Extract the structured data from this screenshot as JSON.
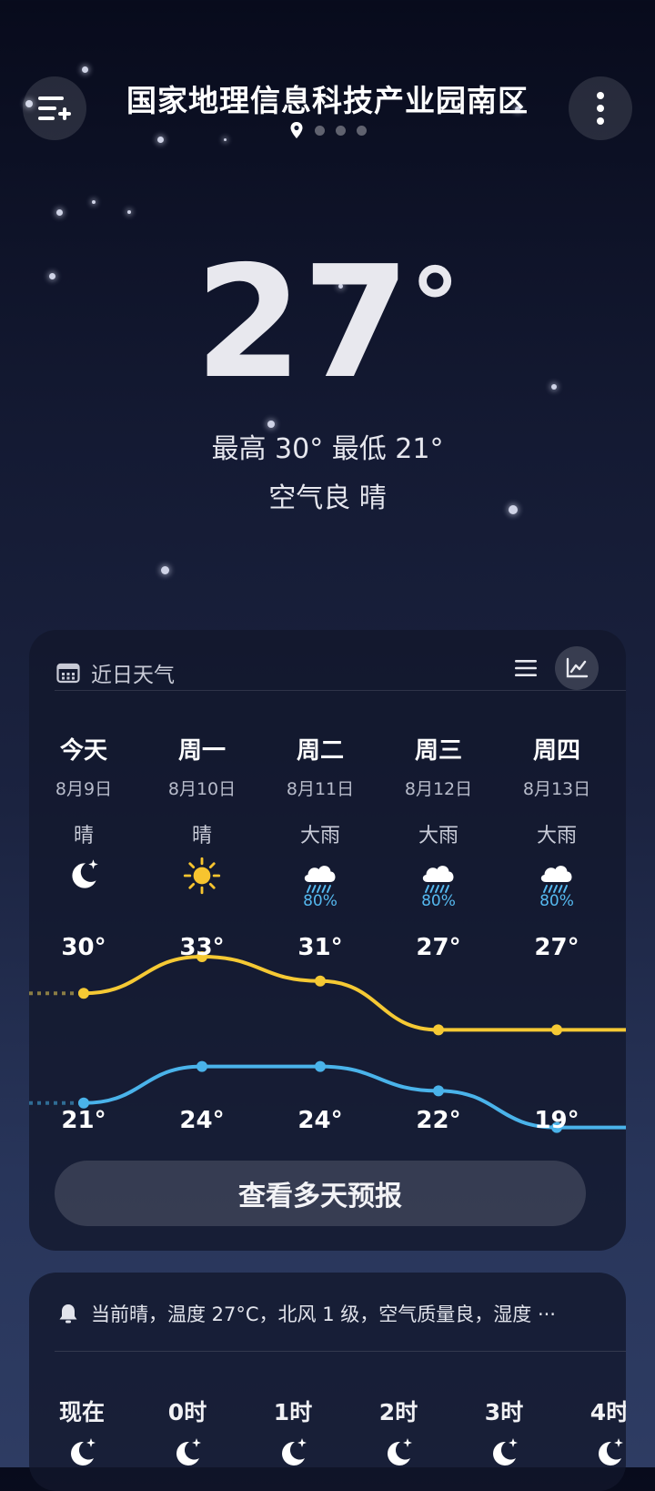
{
  "header": {
    "city": "国家地理信息科技产业园南区",
    "menu_icon": "menu-add-icon",
    "more_icon": "more-vertical-icon",
    "page_count": 4
  },
  "current": {
    "temperature": "27",
    "degree": "°",
    "hilo": "最高 30° 最低 21°",
    "air_condition": "空气良  晴"
  },
  "forecast": {
    "title": "近日天气",
    "list_icon": "list-view-icon",
    "chart_icon": "chart-view-icon",
    "days": [
      {
        "name": "今天",
        "date": "8月9日",
        "condition": "晴",
        "icon": "moon-icon",
        "precip": "",
        "high": "30°",
        "low": "21°"
      },
      {
        "name": "周一",
        "date": "8月10日",
        "condition": "晴",
        "icon": "sun-icon",
        "precip": "",
        "high": "33°",
        "low": "24°"
      },
      {
        "name": "周二",
        "date": "8月11日",
        "condition": "大雨",
        "icon": "heavy-rain-icon",
        "precip": "80%",
        "high": "31°",
        "low": "24°"
      },
      {
        "name": "周三",
        "date": "8月12日",
        "condition": "大雨",
        "icon": "heavy-rain-icon",
        "precip": "80%",
        "high": "27°",
        "low": "22°"
      },
      {
        "name": "周四",
        "date": "8月13日",
        "condition": "大雨",
        "icon": "heavy-rain-icon",
        "precip": "80%",
        "high": "27°",
        "low": "19°"
      }
    ],
    "button_label": "查看多天预报"
  },
  "chart_data": {
    "type": "line",
    "categories": [
      "今天",
      "周一",
      "周二",
      "周三",
      "周四"
    ],
    "series": [
      {
        "values": [
          30,
          33,
          31,
          27,
          27
        ],
        "color": "#f5c934"
      },
      {
        "values": [
          21,
          24,
          24,
          22,
          19
        ],
        "color": "#4ab3ea"
      }
    ]
  },
  "hourly": {
    "notice": "当前晴，温度 27°C，北风 1 级，空气质量良，湿度 ···",
    "notice_icon": "bell-icon",
    "hours": [
      "现在",
      "0时",
      "1时",
      "2时",
      "3时",
      "4时"
    ],
    "hour_icon": "moon-icon"
  }
}
